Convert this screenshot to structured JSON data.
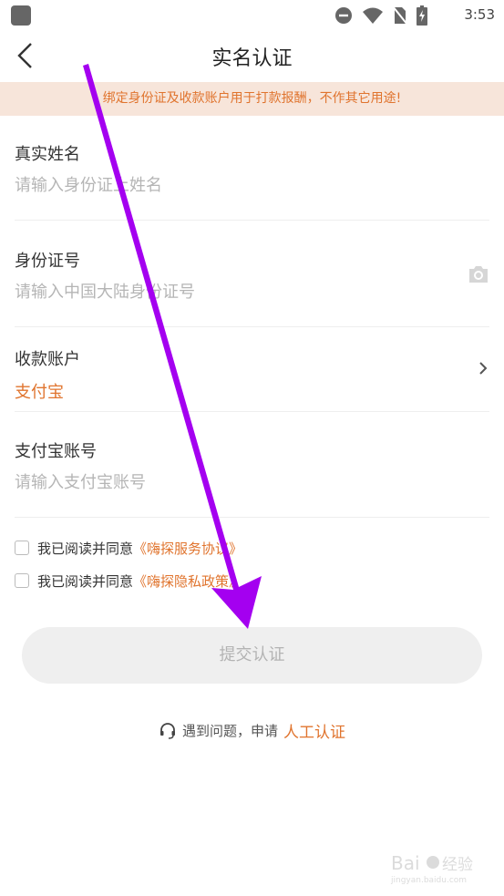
{
  "status_bar": {
    "time": "3:53"
  },
  "header": {
    "title": "实名认证"
  },
  "notice": "绑定身份证及收款账户用于打款报酬，不作其它用途!",
  "form": {
    "name": {
      "label": "真实姓名",
      "placeholder": "请输入身份证上姓名"
    },
    "id_number": {
      "label": "身份证号",
      "placeholder": "请输入中国大陆身份证号"
    },
    "account": {
      "label": "收款账户",
      "value": "支付宝"
    },
    "alipay": {
      "label": "支付宝账号",
      "placeholder": "请输入支付宝账号"
    }
  },
  "agreements": [
    {
      "text": "我已阅读并同意",
      "link": "《嗨探服务协议》"
    },
    {
      "text": "我已阅读并同意",
      "link": "《嗨探隐私政策》"
    }
  ],
  "submit_label": "提交认证",
  "help": {
    "text": "遇到问题，申请",
    "link": "人工认证"
  },
  "colors": {
    "accent": "#e0742e",
    "notice_bg": "#f7e5da",
    "annotation_arrow": "#a400f0"
  },
  "watermark": {
    "line1": "Bai经验",
    "line2": "jingyan.baidu.com"
  }
}
